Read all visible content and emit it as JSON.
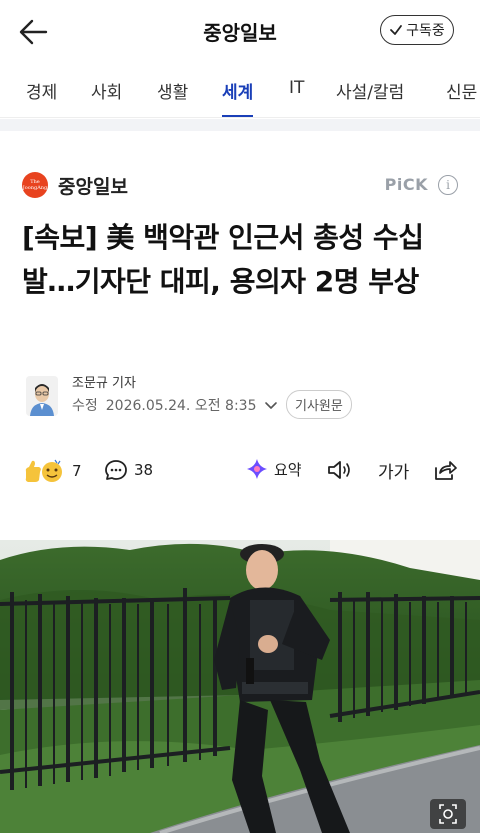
{
  "header": {
    "title": "중앙일보",
    "subscribe_label": "구독중"
  },
  "tabs": [
    {
      "label": "경제",
      "active": false
    },
    {
      "label": "사회",
      "active": false
    },
    {
      "label": "생활",
      "active": false
    },
    {
      "label": "세계",
      "active": true
    },
    {
      "label": "IT",
      "active": false
    },
    {
      "label": "사설/칼럼",
      "active": false
    },
    {
      "label": "신문",
      "active": false
    }
  ],
  "press": {
    "name": "중앙일보",
    "logo_text": "The JoongAng",
    "pick_label": "PiCK",
    "logo_color": "#e8431f"
  },
  "article": {
    "headline": "[속보] 美 백악관 인근서 총성 수십발…기자단 대피, 용의자 2명 부상",
    "reporter": "조문규 기자",
    "edit_label": "수정",
    "edit_time": "2026.05.24. 오전 8:35",
    "source_button": "기사원문"
  },
  "actions": {
    "reactions_count": "7",
    "comments_count": "38",
    "summary_label": "요약",
    "font_size_label": "가가"
  },
  "accent_color": "#1a3fb8"
}
